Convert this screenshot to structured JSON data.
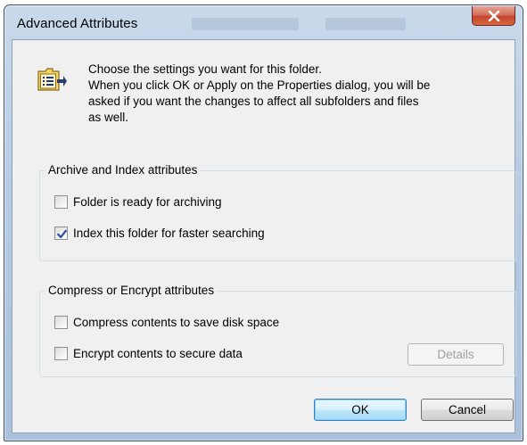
{
  "window": {
    "title": "Advanced Attributes"
  },
  "header": {
    "line1": "Choose the settings you want for this folder.",
    "line2": "When you click OK or Apply on the Properties dialog, you will be",
    "line3": "asked if you want the changes to affect all subfolders and files",
    "line4": "as well."
  },
  "archive_group": {
    "label": "Archive and Index attributes",
    "options": [
      {
        "label": "Folder is ready for archiving",
        "checked": false
      },
      {
        "label": "Index this folder for faster searching",
        "checked": true
      }
    ]
  },
  "compress_group": {
    "label": "Compress or Encrypt attributes",
    "options": [
      {
        "label": "Compress contents to save disk space",
        "checked": false
      },
      {
        "label": "Encrypt contents to secure data",
        "checked": false
      }
    ],
    "details_label": "Details"
  },
  "buttons": {
    "ok": "OK",
    "cancel": "Cancel"
  },
  "colors": {
    "close_button": "#c2462d",
    "title_frame": "#b7cce3",
    "dialog_bg": "#f0f0f0",
    "default_button_border": "#3c7fb1"
  },
  "icons": {
    "close": "close-x-icon",
    "header": "folder-properties-icon",
    "check": "checkmark-icon"
  }
}
